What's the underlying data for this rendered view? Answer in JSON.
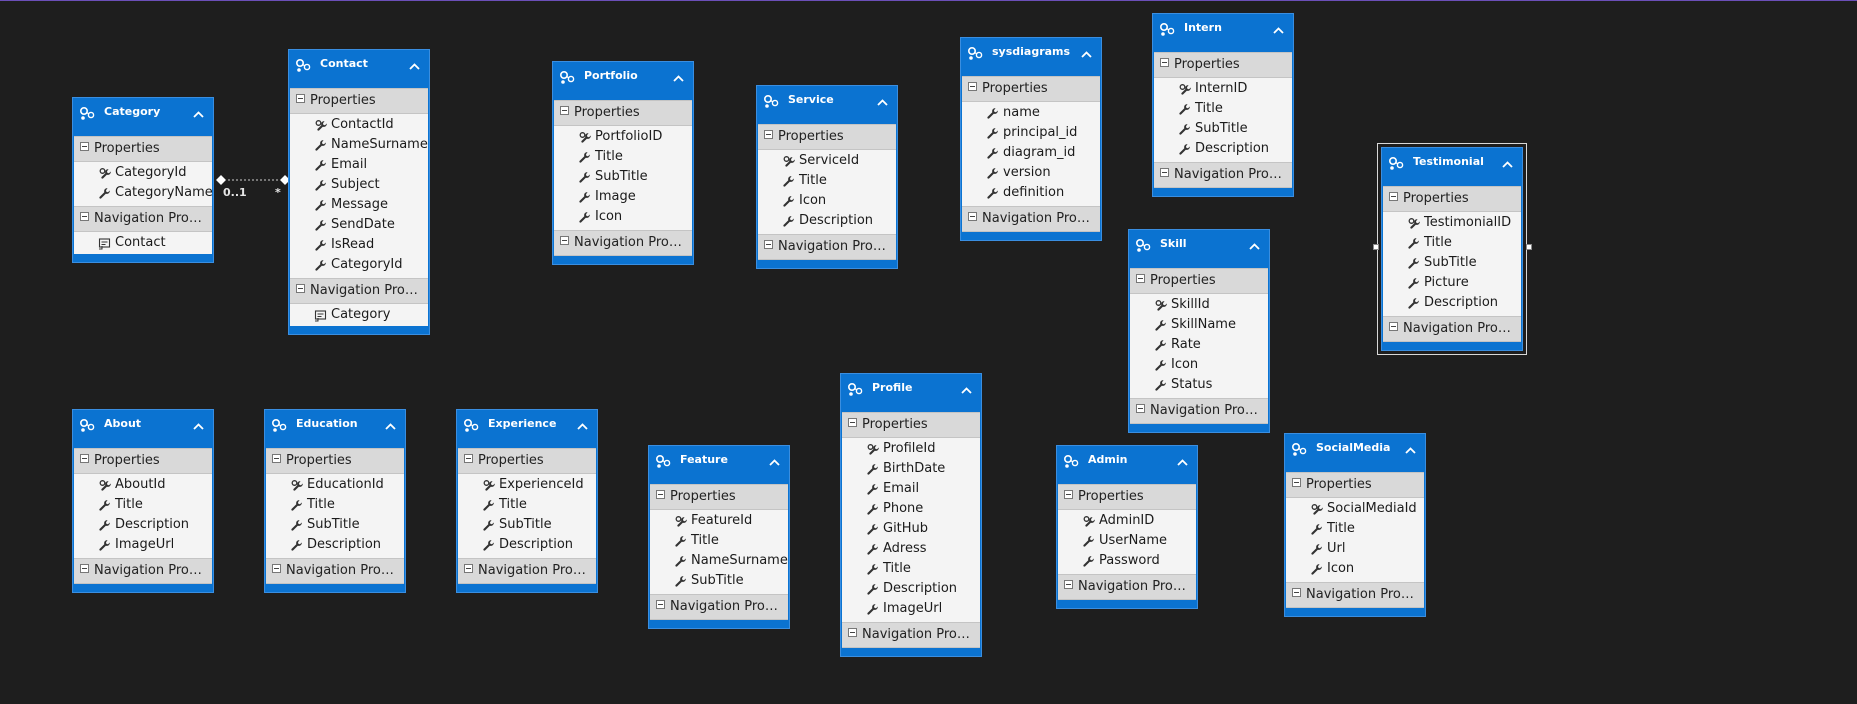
{
  "section_properties": "Properties",
  "section_navigation": "Navigation  Prope...",
  "colors": {
    "canvas": "#1e1e1e",
    "entity_header": "#0b73d1",
    "section": "#d9d9d9",
    "body": "#f4f4f4"
  },
  "relationship": {
    "from_label": "0..1",
    "to_label": "*"
  },
  "entities": [
    {
      "name": "Category",
      "props": [
        {
          "n": "CategoryId",
          "k": true
        },
        {
          "n": "CategoryName",
          "k": false
        }
      ],
      "nav": [
        "Contact"
      ]
    },
    {
      "name": "Contact",
      "props": [
        {
          "n": "ContactId",
          "k": true
        },
        {
          "n": "NameSurname",
          "k": false
        },
        {
          "n": "Email",
          "k": false
        },
        {
          "n": "Subject",
          "k": false
        },
        {
          "n": "Message",
          "k": false
        },
        {
          "n": "SendDate",
          "k": false
        },
        {
          "n": "IsRead",
          "k": false
        },
        {
          "n": "CategoryId",
          "k": false
        }
      ],
      "nav": [
        "Category"
      ]
    },
    {
      "name": "Portfolio",
      "props": [
        {
          "n": "PortfolioID",
          "k": true
        },
        {
          "n": "Title",
          "k": false
        },
        {
          "n": "SubTitle",
          "k": false
        },
        {
          "n": "Image",
          "k": false
        },
        {
          "n": "Icon",
          "k": false
        }
      ],
      "nav": []
    },
    {
      "name": "Service",
      "props": [
        {
          "n": "ServiceId",
          "k": true
        },
        {
          "n": "Title",
          "k": false
        },
        {
          "n": "Icon",
          "k": false
        },
        {
          "n": "Description",
          "k": false
        }
      ],
      "nav": []
    },
    {
      "name": "sysdiagrams",
      "props": [
        {
          "n": "name",
          "k": false
        },
        {
          "n": "principal_id",
          "k": false
        },
        {
          "n": "diagram_id",
          "k": false
        },
        {
          "n": "version",
          "k": false
        },
        {
          "n": "definition",
          "k": false
        }
      ],
      "nav": []
    },
    {
      "name": "Intern",
      "props": [
        {
          "n": "InternID",
          "k": true
        },
        {
          "n": "Title",
          "k": false
        },
        {
          "n": "SubTitle",
          "k": false
        },
        {
          "n": "Description",
          "k": false
        }
      ],
      "nav": []
    },
    {
      "name": "Testimonial",
      "props": [
        {
          "n": "TestimonialID",
          "k": true
        },
        {
          "n": "Title",
          "k": false
        },
        {
          "n": "SubTitle",
          "k": false
        },
        {
          "n": "Picture",
          "k": false
        },
        {
          "n": "Description",
          "k": false
        }
      ],
      "nav": [],
      "selected": true
    },
    {
      "name": "Skill",
      "props": [
        {
          "n": "SkillId",
          "k": true
        },
        {
          "n": "SkillName",
          "k": false
        },
        {
          "n": "Rate",
          "k": false
        },
        {
          "n": "Icon",
          "k": false
        },
        {
          "n": "Status",
          "k": false
        }
      ],
      "nav": []
    },
    {
      "name": "About",
      "props": [
        {
          "n": "AboutId",
          "k": true
        },
        {
          "n": "Title",
          "k": false
        },
        {
          "n": "Description",
          "k": false
        },
        {
          "n": "ImageUrl",
          "k": false
        }
      ],
      "nav": []
    },
    {
      "name": "Education",
      "props": [
        {
          "n": "EducationId",
          "k": true
        },
        {
          "n": "Title",
          "k": false
        },
        {
          "n": "SubTitle",
          "k": false
        },
        {
          "n": "Description",
          "k": false
        }
      ],
      "nav": []
    },
    {
      "name": "Experience",
      "props": [
        {
          "n": "ExperienceId",
          "k": true
        },
        {
          "n": "Title",
          "k": false
        },
        {
          "n": "SubTitle",
          "k": false
        },
        {
          "n": "Description",
          "k": false
        }
      ],
      "nav": []
    },
    {
      "name": "Feature",
      "props": [
        {
          "n": "FeatureId",
          "k": true
        },
        {
          "n": "Title",
          "k": false
        },
        {
          "n": "NameSurname",
          "k": false
        },
        {
          "n": "SubTitle",
          "k": false
        }
      ],
      "nav": []
    },
    {
      "name": "Profile",
      "props": [
        {
          "n": "ProfileId",
          "k": true
        },
        {
          "n": "BirthDate",
          "k": false
        },
        {
          "n": "Email",
          "k": false
        },
        {
          "n": "Phone",
          "k": false
        },
        {
          "n": "GitHub",
          "k": false
        },
        {
          "n": "Adress",
          "k": false
        },
        {
          "n": "Title",
          "k": false
        },
        {
          "n": "Description",
          "k": false
        },
        {
          "n": "ImageUrl",
          "k": false
        }
      ],
      "nav": []
    },
    {
      "name": "Admin",
      "props": [
        {
          "n": "AdminID",
          "k": true
        },
        {
          "n": "UserName",
          "k": false
        },
        {
          "n": "Password",
          "k": false
        }
      ],
      "nav": []
    },
    {
      "name": "SocialMedia",
      "props": [
        {
          "n": "SocialMediaId",
          "k": true
        },
        {
          "n": "Title",
          "k": false
        },
        {
          "n": "Url",
          "k": false
        },
        {
          "n": "Icon",
          "k": false
        }
      ],
      "nav": []
    }
  ]
}
